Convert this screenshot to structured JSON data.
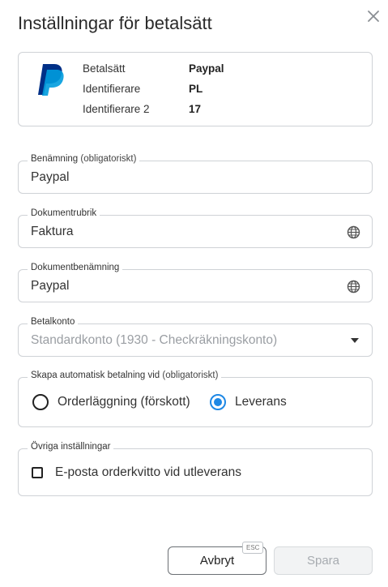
{
  "dialog": {
    "title": "Inställningar för betalsätt",
    "close_icon": "close-icon"
  },
  "info": {
    "logo_icon": "paypal-logo",
    "rows": [
      {
        "label": "Betalsätt",
        "value": "Paypal"
      },
      {
        "label": "Identifierare",
        "value": "PL"
      },
      {
        "label": "Identifierare 2",
        "value": "17"
      }
    ]
  },
  "fields": {
    "name": {
      "label": "Benämning",
      "required": "(obligatoriskt)",
      "value": "Paypal"
    },
    "doc_header": {
      "label": "Dokumentrubrik",
      "value": "Faktura",
      "icon": "globe-icon"
    },
    "doc_name": {
      "label": "Dokumentbenämning",
      "value": "Paypal",
      "icon": "globe-icon"
    },
    "account": {
      "label": "Betalkonto",
      "value": "Standardkonto (1930 - Checkräkningskonto)",
      "icon": "chevron-down-icon"
    }
  },
  "auto_payment": {
    "label": "Skapa automatisk betalning vid",
    "required": "(obligatoriskt)",
    "options": [
      {
        "label": "Orderläggning (förskott)",
        "checked": false
      },
      {
        "label": "Leverans",
        "checked": true
      }
    ]
  },
  "other": {
    "label": "Övriga inställningar",
    "checkbox_label": "E-posta orderkvitto vid utleverans",
    "checked": false
  },
  "footer": {
    "cancel_label": "Avbryt",
    "esc_badge": "ESC",
    "save_label": "Spara"
  },
  "colors": {
    "accent": "#1e88e5",
    "paypal_dark": "#003087",
    "paypal_light": "#009cde"
  }
}
